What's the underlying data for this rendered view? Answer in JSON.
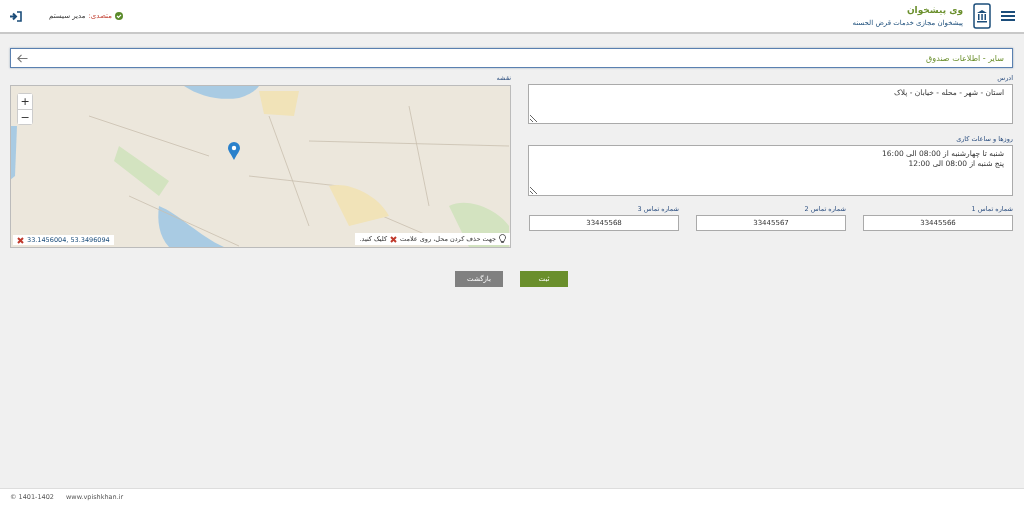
{
  "header": {
    "title": "وی پیشخوان",
    "subtitle": "پیشخوان مجازی خدمات قرض الحسنه",
    "user_label": "متصدی:",
    "user_name": "مدیر سیستم",
    "online": true
  },
  "breadcrumb": {
    "text": "سایر - اطلاعات صندوق"
  },
  "address": {
    "label": "ادرس",
    "value": "استان - شهر - محله - خیابان - پلاک"
  },
  "hours": {
    "label": "روزها و ساعات کاری",
    "value": "شنبه تا چهارشنبه از 08:00 الی 16:00\nپنج شنبه از 08:00 الی 12:00"
  },
  "phones": [
    {
      "label": "شماره تماس 1",
      "value": "33445566"
    },
    {
      "label": "شماره تماس 2",
      "value": "33445567"
    },
    {
      "label": "شماره تماس 3",
      "value": "33445568"
    }
  ],
  "map": {
    "label": "نقشه",
    "zoom_in": "+",
    "zoom_out": "−",
    "coordinates": "33.1456004, 53.3496094",
    "hint_before": "جهت حذف کردن محل، روی علامت",
    "hint_after": "کلیک کنید."
  },
  "buttons": [
    {
      "label": "ثبت",
      "kind": "primary"
    },
    {
      "label": "بازگشت",
      "kind": "secondary"
    }
  ],
  "footer": {
    "copyright": "© 1401-1402",
    "website": "www.vpishkhan.ir"
  }
}
